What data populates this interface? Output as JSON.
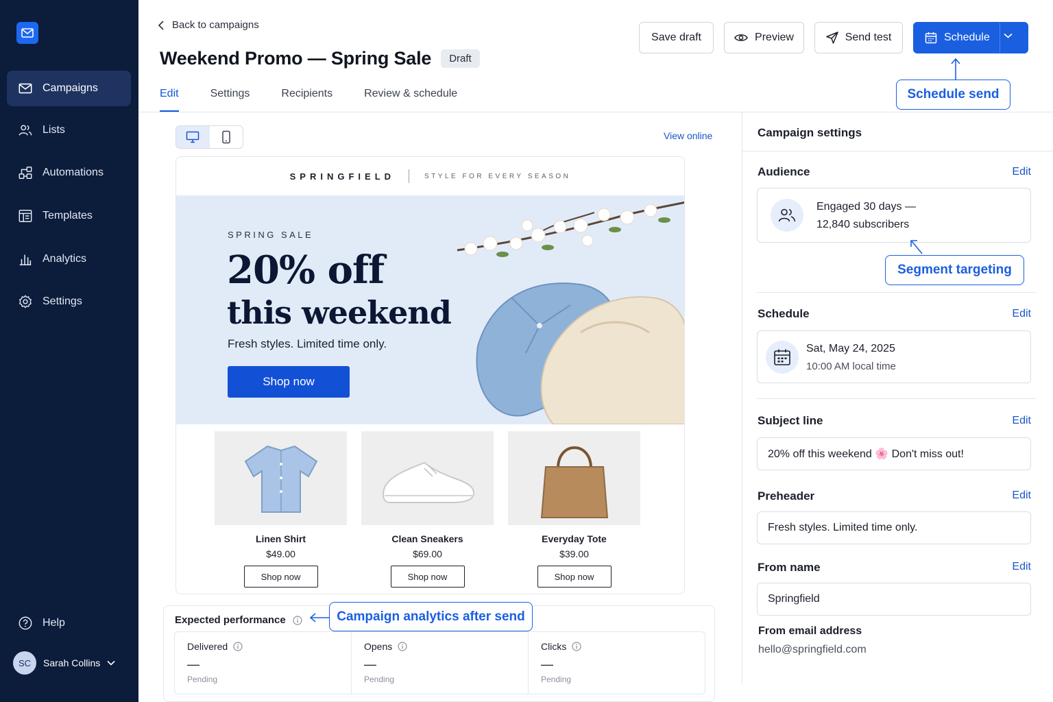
{
  "sidebar": {
    "items": [
      {
        "label": "Campaigns",
        "icon": "mail-icon"
      },
      {
        "label": "Lists",
        "icon": "users-icon"
      },
      {
        "label": "Automations",
        "icon": "automation-icon"
      },
      {
        "label": "Templates",
        "icon": "template-icon"
      },
      {
        "label": "Analytics",
        "icon": "bar-chart-icon"
      },
      {
        "label": "Settings",
        "icon": "gear-icon"
      }
    ],
    "help_label": "Help",
    "user": {
      "initials": "SC",
      "name": "Sarah Collins"
    }
  },
  "header": {
    "back_label": "Back to campaigns",
    "title": "Weekend Promo — Spring Sale",
    "status": "Draft",
    "tabs": [
      "Edit",
      "Settings",
      "Recipients",
      "Review & schedule"
    ],
    "active_tab": "Edit"
  },
  "actions": {
    "save_draft": "Save draft",
    "preview": "Preview",
    "send_test": "Send test",
    "schedule": "Schedule"
  },
  "callouts": {
    "schedule": "Schedule send",
    "segment": "Segment targeting",
    "analytics": "Campaign analytics after send"
  },
  "editor": {
    "view_online": "View online",
    "device": "desktop",
    "email": {
      "brand": "SPRINGFIELD",
      "tagline": "STYLE FOR EVERY SEASON",
      "kicker": "SPRING SALE",
      "headline_1": "20% off",
      "headline_2": "this weekend",
      "subhead": "Fresh styles. Limited time only.",
      "cta": "Shop now",
      "products": [
        {
          "name": "Linen Shirt",
          "price": "$49.00",
          "cta": "Shop now"
        },
        {
          "name": "Clean Sneakers",
          "price": "$69.00",
          "cta": "Shop now"
        },
        {
          "name": "Everyday Tote",
          "price": "$39.00",
          "cta": "Shop now"
        }
      ]
    }
  },
  "performance": {
    "title": "Expected performance",
    "metrics": [
      {
        "label": "Delivered",
        "value": "—",
        "status": "Pending"
      },
      {
        "label": "Opens",
        "value": "—",
        "status": "Pending"
      },
      {
        "label": "Clicks",
        "value": "—",
        "status": "Pending"
      }
    ]
  },
  "settings_panel": {
    "title": "Campaign settings",
    "edit_label": "Edit",
    "audience": {
      "label": "Audience",
      "line1": "Engaged 30 days —",
      "line2": "12,840 subscribers"
    },
    "schedule": {
      "label": "Schedule",
      "date": "Sat, May 24, 2025",
      "time": "10:00 AM local time"
    },
    "subject": {
      "label": "Subject line",
      "value": "20% off this weekend 🌸 Don't miss out!"
    },
    "preheader": {
      "label": "Preheader",
      "value": "Fresh styles. Limited time only."
    },
    "from_name": {
      "label": "From name",
      "value": "Springfield"
    },
    "from_email": {
      "label": "From email address",
      "value": "hello@springfield.com"
    }
  },
  "colors": {
    "sidebar_bg": "#0c1c3b",
    "accent": "#1a5fe0",
    "hero_bg": "#e1ebf8"
  }
}
